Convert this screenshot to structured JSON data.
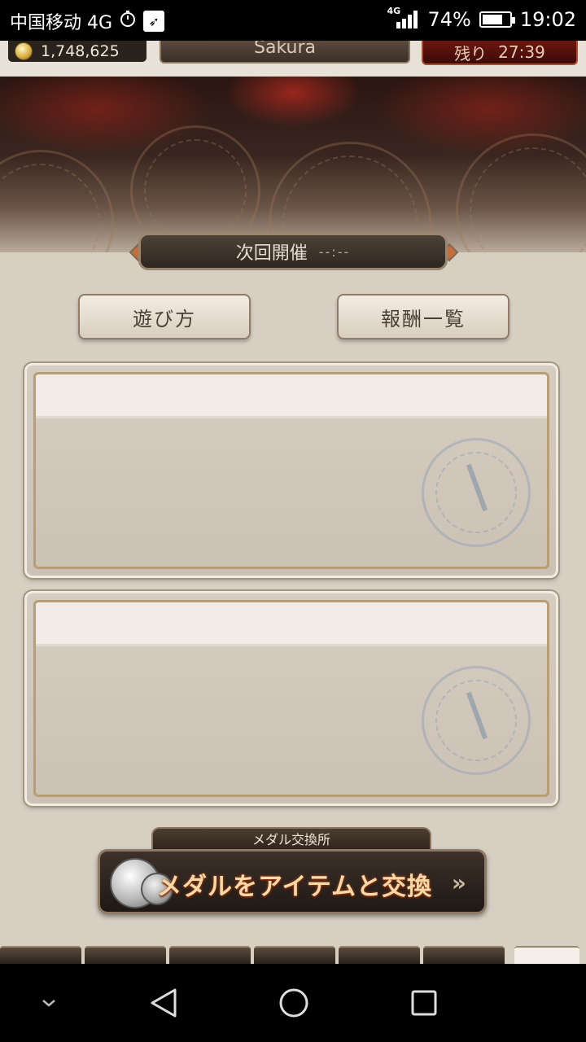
{
  "status_bar": {
    "carrier": "中国移动 4G",
    "alarm_icon": "stopwatch-icon",
    "app_icon": "bird-notification-icon",
    "network_tag": "4G",
    "battery": "74%",
    "battery_level": 0.74,
    "time": "19:02"
  },
  "game_header": {
    "coin_amount": "1,748,625",
    "player_name": "Sakura",
    "timer_label": "残り",
    "timer_value": "27:39"
  },
  "event": {
    "next_label": "次回開催",
    "next_time": "--:--"
  },
  "buttons": {
    "how_to_play": "遊び方",
    "rewards_list": "報酬一覧"
  },
  "medal_exchange": {
    "section_label": "メダル交換所",
    "button_label": "メダルをアイテムと交換"
  },
  "colors": {
    "parchment": "#d8cfc3",
    "plate_dark": "#3a2f27",
    "timer_red": "#6e1610",
    "medal_text": "#f5d9a7"
  },
  "nav": {
    "back_icon": "back-triangle-icon",
    "home_icon": "home-circle-icon",
    "recents_icon": "recents-square-icon",
    "hide_icon": "chevron-down-icon"
  }
}
